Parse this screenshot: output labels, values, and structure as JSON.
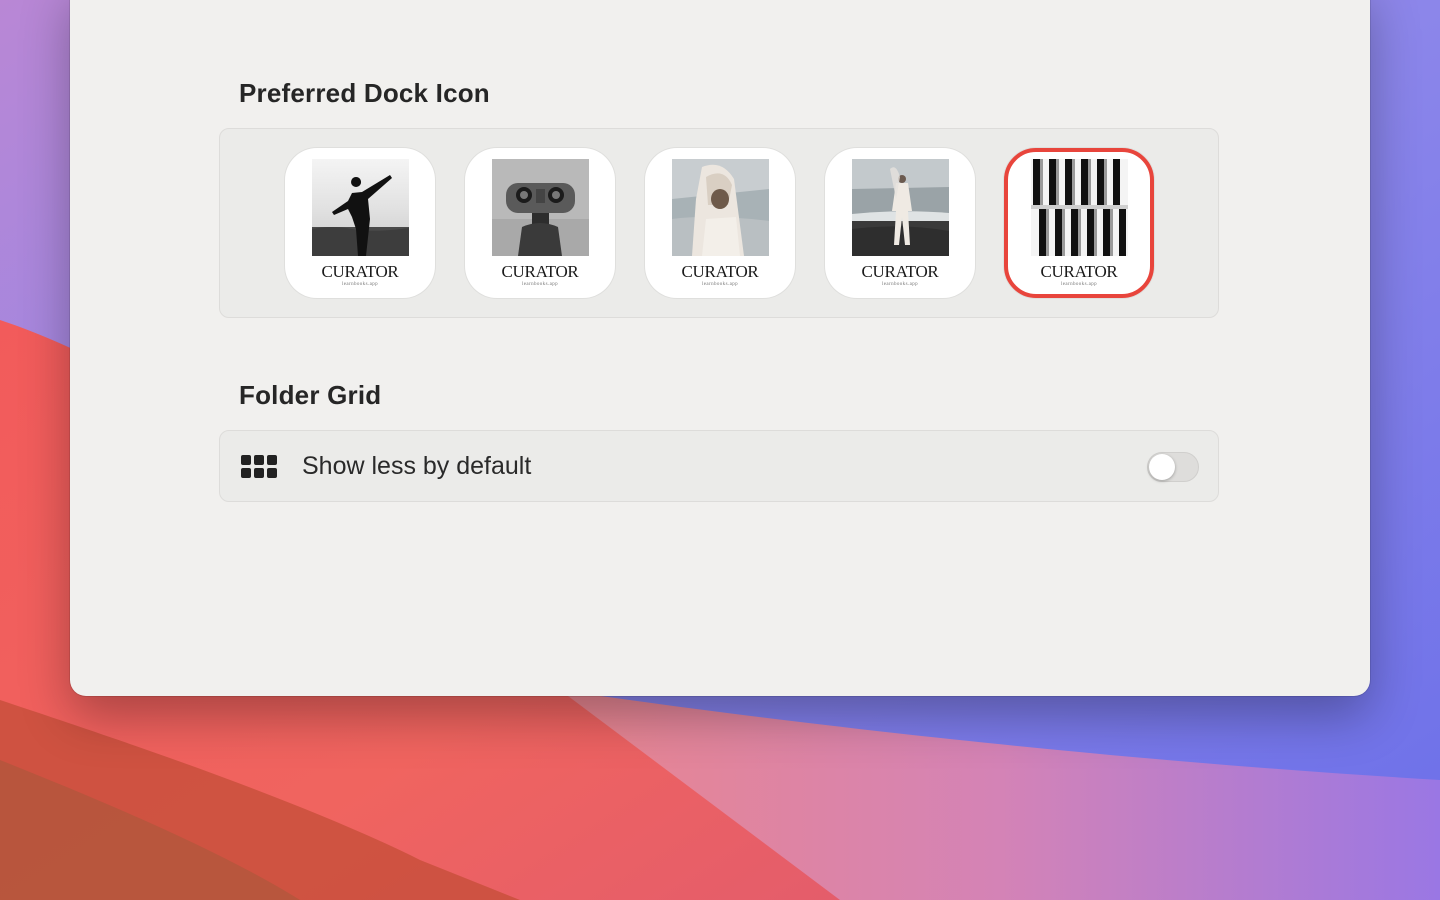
{
  "colors": {
    "window_bg": "#f1f0ee",
    "panel_bg": "#ebebe9",
    "selected_border": "#e8453c",
    "toggle_off": "#dedddb"
  },
  "dock_icon": {
    "title": "Preferred Dock Icon",
    "selected_index": 4,
    "options": [
      {
        "brand": "CURATOR",
        "sub": "learnbooks.app",
        "photo": "silhouette-raised-arm"
      },
      {
        "brand": "CURATOR",
        "sub": "learnbooks.app",
        "photo": "coin-binoculars"
      },
      {
        "brand": "CURATOR",
        "sub": "learnbooks.app",
        "photo": "veiled-figure-sea"
      },
      {
        "brand": "CURATOR",
        "sub": "learnbooks.app",
        "photo": "person-walking-beach"
      },
      {
        "brand": "CURATOR",
        "sub": "learnbooks.app",
        "photo": "architectural-fins"
      }
    ]
  },
  "folder_grid": {
    "title": "Folder Grid",
    "icon": "grid-icon",
    "label": "Show less by default",
    "toggle_on": false
  }
}
